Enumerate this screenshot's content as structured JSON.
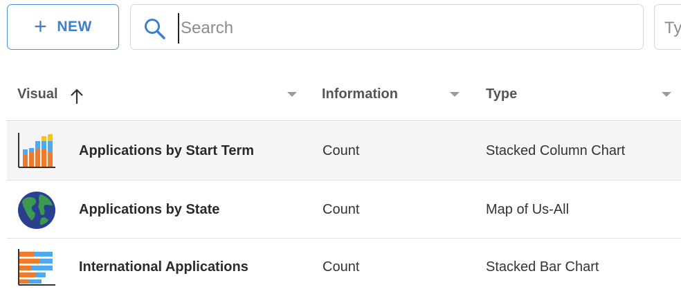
{
  "toolbar": {
    "new_button_icon": "plus-icon",
    "new_button_label": "NEW",
    "search_icon": "search-icon",
    "search_placeholder": "Search",
    "type_filter_placeholder": "Ty",
    "accent_color": "#3d7fcc"
  },
  "table": {
    "columns": [
      {
        "label": "Visual",
        "sort": "ascending",
        "sort_icon": "arrow-up-icon"
      },
      {
        "label": "Information"
      },
      {
        "label": "Type"
      }
    ],
    "rows": [
      {
        "icon": "stacked-column-chart-icon",
        "name": "Applications by Start Term",
        "information": "Count",
        "type": "Stacked Column Chart",
        "selected": true
      },
      {
        "icon": "globe-icon",
        "name": "Applications by State",
        "information": "Count",
        "type": "Map of Us-All"
      },
      {
        "icon": "stacked-bar-chart-icon",
        "name": "International Applications",
        "information": "Count",
        "type": "Stacked Bar Chart"
      }
    ]
  }
}
